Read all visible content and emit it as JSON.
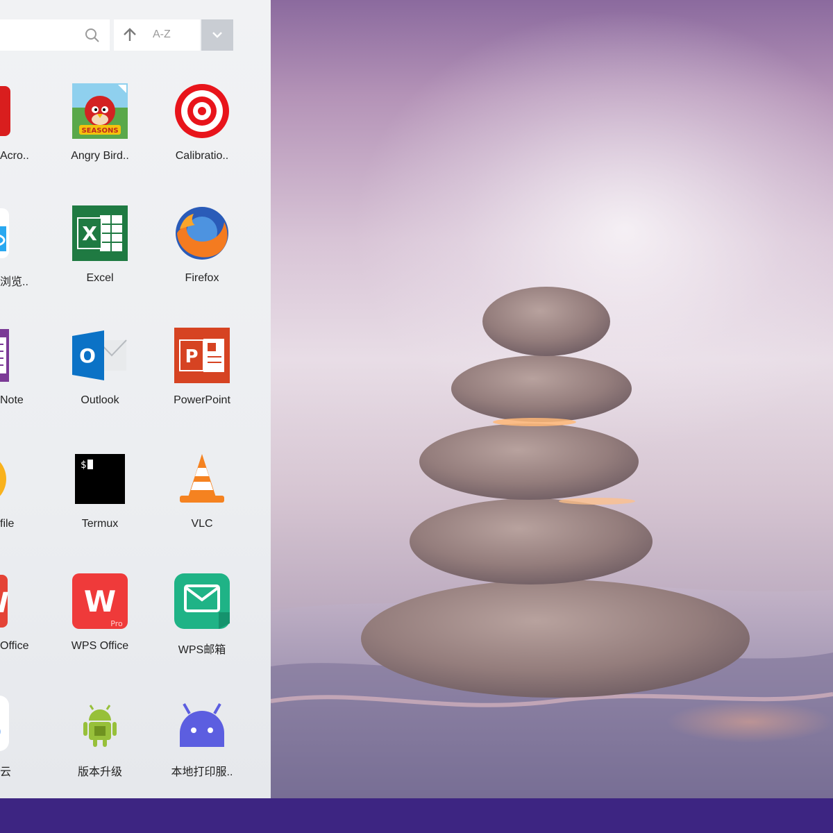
{
  "search": {
    "placeholder": ""
  },
  "sort": {
    "label": "A-Z"
  },
  "apps": [
    {
      "label": "Acro..",
      "icon": "acrobat-icon"
    },
    {
      "label": "Angry Bird..",
      "icon": "angry-birds-icon"
    },
    {
      "label": "Calibratio..",
      "icon": "target-icon"
    },
    {
      "label": "浏览..",
      "icon": "file-browser-icon"
    },
    {
      "label": "Excel",
      "icon": "excel-icon"
    },
    {
      "label": "Firefox",
      "icon": "firefox-icon"
    },
    {
      "label": "Note",
      "icon": "onenote-icon"
    },
    {
      "label": "Outlook",
      "icon": "outlook-icon"
    },
    {
      "label": "PowerPoint",
      "icon": "powerpoint-icon"
    },
    {
      "label": "file",
      "icon": "cloud-file-icon"
    },
    {
      "label": "Termux",
      "icon": "terminal-icon"
    },
    {
      "label": "VLC",
      "icon": "vlc-cone-icon"
    },
    {
      "label": "Office",
      "icon": "wps-office-icon"
    },
    {
      "label": "WPS Office",
      "icon": "wps-office-pro-icon"
    },
    {
      "label": "WPS邮箱",
      "icon": "wps-mail-icon"
    },
    {
      "label": "云",
      "icon": "cloud-drive-icon"
    },
    {
      "label": "版本升级",
      "icon": "android-update-icon"
    },
    {
      "label": "本地打印服..",
      "icon": "android-icon"
    }
  ],
  "colors": {
    "taskbar": "#3d2582",
    "launcher_bg": "#eceef1",
    "dropdown_bg": "#c9cdd3"
  }
}
